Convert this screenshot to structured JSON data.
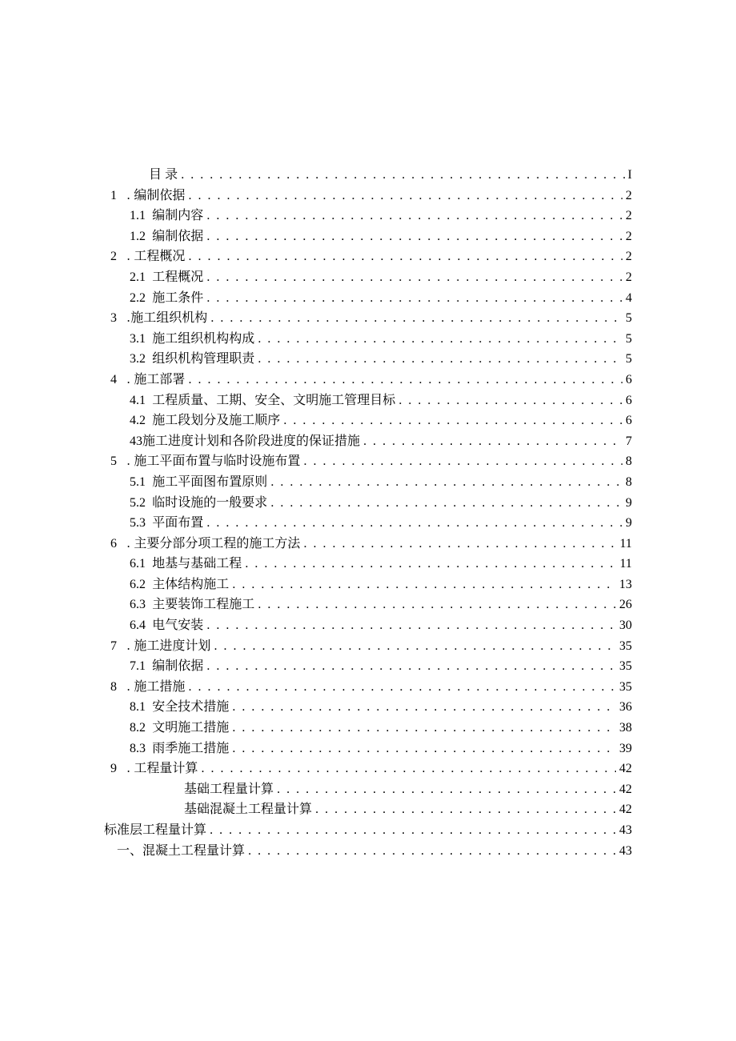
{
  "toc": [
    {
      "lv": "lv-title",
      "num": "",
      "label": "目 录",
      "page": "I"
    },
    {
      "lv": "lv0",
      "num": "1",
      "label": ". 编制依据",
      "page": "2"
    },
    {
      "lv": "lv1",
      "num": "",
      "sub": "1.1",
      "label": "编制内容",
      "page": "2"
    },
    {
      "lv": "lv1",
      "num": "",
      "sub": "1.2",
      "label": "编制依据",
      "page": "2"
    },
    {
      "lv": "lv0",
      "num": "2",
      "label": ". 工程概况",
      "page": "2"
    },
    {
      "lv": "lv1",
      "num": "",
      "sub": "2.1",
      "label": "工程概况",
      "page": "2"
    },
    {
      "lv": "lv1",
      "num": "",
      "sub": "2.2",
      "label": "施工条件",
      "page": "4"
    },
    {
      "lv": "lv0",
      "num": "3",
      "label": ".施工组织机构",
      "page": "5"
    },
    {
      "lv": "lv1",
      "num": "",
      "sub": "3.1",
      "label": "施工组织机构构成",
      "page": "5"
    },
    {
      "lv": "lv1",
      "num": "",
      "sub": "3.2",
      "label": "组织机构管理职责",
      "page": "5"
    },
    {
      "lv": "lv0",
      "num": "4",
      "label": ". 施工部署",
      "page": "6"
    },
    {
      "lv": "lv1",
      "num": "",
      "sub": "4.1",
      "label": "工程质量、工期、安全、文明施工管理目标",
      "page": "6"
    },
    {
      "lv": "lv1",
      "num": "",
      "sub": "4.2",
      "label": "施工段划分及施工顺序",
      "page": "6"
    },
    {
      "lv": "lv1",
      "num": "",
      "sub": "43",
      "label": "施工进度计划和各阶段进度的保证措施",
      "page": "7",
      "tight": true
    },
    {
      "lv": "lv0",
      "num": "5",
      "label": ". 施工平面布置与临时设施布置",
      "page": "8"
    },
    {
      "lv": "lv1",
      "num": "",
      "sub": "5.1",
      "label": "施工平面图布置原则",
      "page": "8"
    },
    {
      "lv": "lv1",
      "num": "",
      "sub": "5.2",
      "label": "临时设施的一般要求",
      "page": "9"
    },
    {
      "lv": "lv1",
      "num": "",
      "sub": "5.3",
      "label": "平面布置",
      "page": "9"
    },
    {
      "lv": "lv0",
      "num": "6",
      "label": ". 主要分部分项工程的施工方法",
      "page": "11"
    },
    {
      "lv": "lv1",
      "num": "",
      "sub": "6.1",
      "label": "地基与基础工程",
      "page": "11"
    },
    {
      "lv": "lv1",
      "num": "",
      "sub": "6.2",
      "label": "主体结构施工",
      "page": "13"
    },
    {
      "lv": "lv1",
      "num": "",
      "sub": "6.3",
      "label": "主要装饰工程施工",
      "page": "26"
    },
    {
      "lv": "lv1",
      "num": "",
      "sub": "6.4",
      "label": "电气安装",
      "page": "30"
    },
    {
      "lv": "lv0",
      "num": "7",
      "label": ". 施工进度计划",
      "page": "35"
    },
    {
      "lv": "lv1",
      "num": "",
      "sub": "7.1",
      "label": "编制依据",
      "page": "35"
    },
    {
      "lv": "lv0",
      "num": "8",
      "label": ". 施工措施",
      "page": "35"
    },
    {
      "lv": "lv1",
      "num": "",
      "sub": "8.1",
      "label": "安全技术措施",
      "page": "36"
    },
    {
      "lv": "lv1",
      "num": "",
      "sub": "8.2",
      "label": "文明施工措施",
      "page": "38"
    },
    {
      "lv": "lv1",
      "num": "",
      "sub": "8.3",
      "label": "雨季施工措施",
      "page": "39"
    },
    {
      "lv": "lv0",
      "num": "9",
      "label": ". 工程量计算",
      "page": "42"
    },
    {
      "lv": "lv2",
      "num": "",
      "label": "基础工程量计算",
      "page": "42"
    },
    {
      "lv": "lv2",
      "num": "",
      "label": "基础混凝土工程量计算",
      "page": "42"
    },
    {
      "lv": "lv-std",
      "num": "",
      "label": "标准层工程量计算",
      "page": "43"
    },
    {
      "lv": "lv-std2",
      "num": "",
      "label": "一、混凝土工程量计算",
      "page": "43"
    }
  ]
}
